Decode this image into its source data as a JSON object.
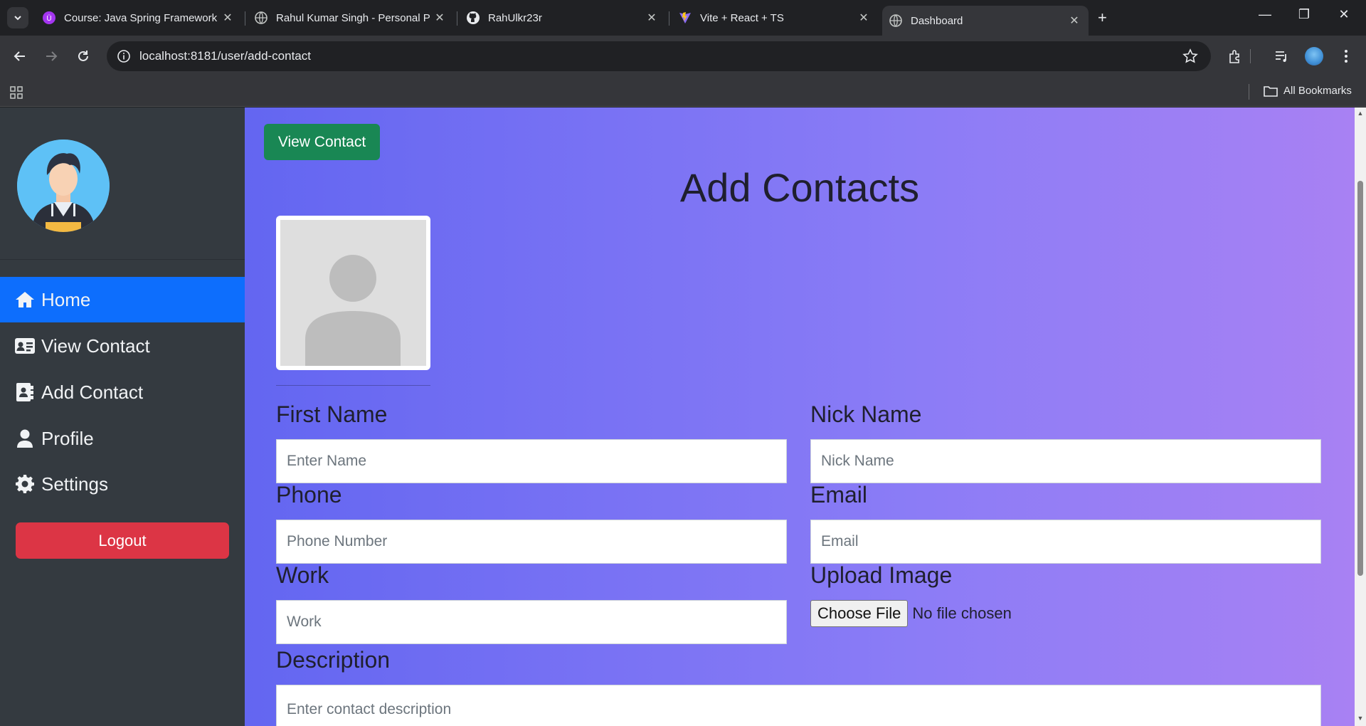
{
  "browser": {
    "tabs": [
      {
        "title": "Course: Java Spring Framework",
        "icon": "udemy-icon"
      },
      {
        "title": "Rahul Kumar Singh - Personal P",
        "icon": "globe-icon"
      },
      {
        "title": "RahUlkr23r",
        "icon": "github-icon"
      },
      {
        "title": "Vite + React + TS",
        "icon": "vite-icon"
      },
      {
        "title": "Dashboard",
        "icon": "globe-icon",
        "active": true
      }
    ],
    "url": "localhost:8181/user/add-contact",
    "bookmarks_label": "All Bookmarks"
  },
  "sidebar": {
    "items": [
      {
        "label": "Home",
        "icon": "home-icon",
        "active": true
      },
      {
        "label": "View Contact",
        "icon": "id-card-icon"
      },
      {
        "label": "Add Contact",
        "icon": "address-book-icon"
      },
      {
        "label": "Profile",
        "icon": "user-icon"
      },
      {
        "label": "Settings",
        "icon": "gear-icon"
      }
    ],
    "logout_label": "Logout"
  },
  "main": {
    "view_contact_button": "View Contact",
    "title": "Add Contacts",
    "fields": {
      "first_name": {
        "label": "First Name",
        "placeholder": "Enter Name"
      },
      "nick_name": {
        "label": "Nick Name",
        "placeholder": "Nick Name"
      },
      "phone": {
        "label": "Phone",
        "placeholder": "Phone Number"
      },
      "email": {
        "label": "Email",
        "placeholder": "Email"
      },
      "work": {
        "label": "Work",
        "placeholder": "Work"
      },
      "upload": {
        "label": "Upload Image",
        "button": "Choose File",
        "status": "No file chosen"
      },
      "description": {
        "label": "Description",
        "placeholder": "Enter contact description"
      }
    }
  },
  "colors": {
    "sidebar_bg": "#343a40",
    "active_item": "#0d6efd",
    "logout": "#dc3545",
    "view_contact_btn": "#198754",
    "gradient_start": "#6366f1",
    "gradient_end": "#a881f3"
  }
}
